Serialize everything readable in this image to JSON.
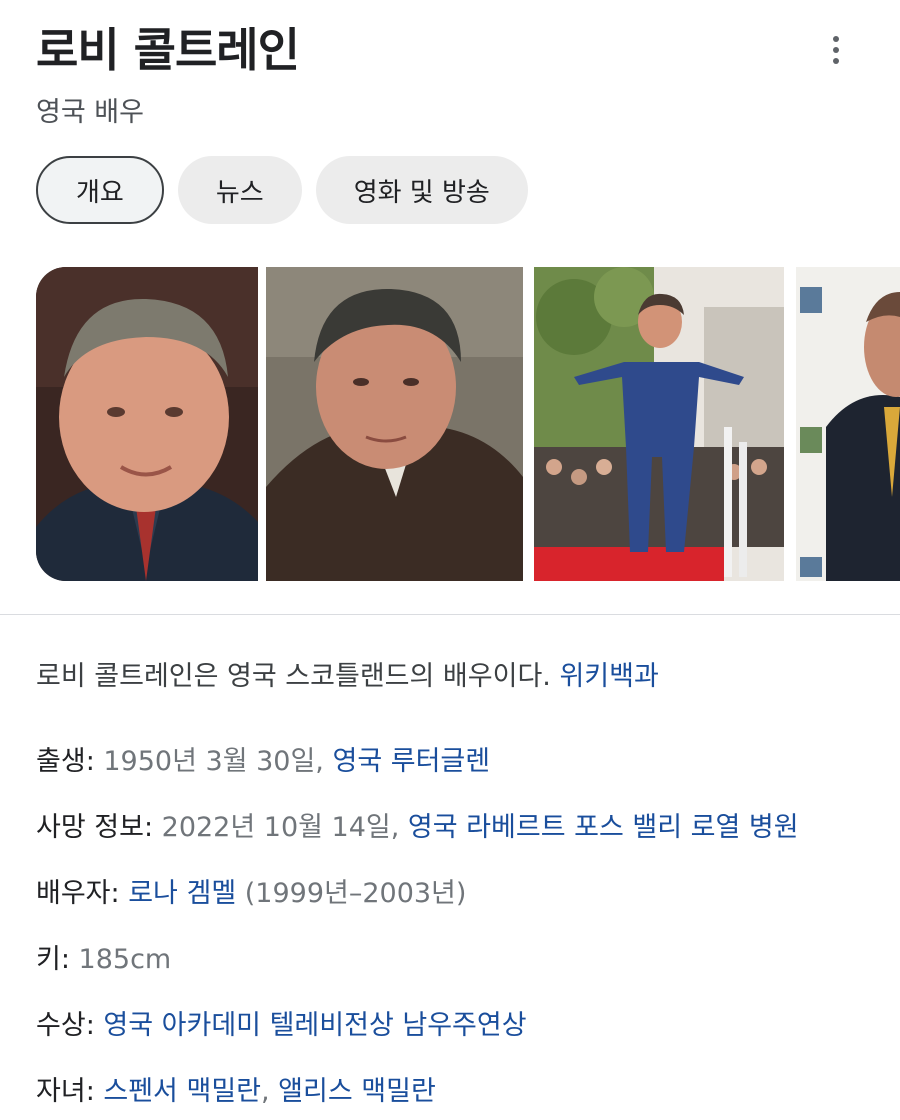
{
  "header": {
    "title": "로비 콜트레인",
    "subtitle": "영국 배우",
    "more_icon": "more-vert-icon"
  },
  "tabs": [
    {
      "label": "개요",
      "active": true
    },
    {
      "label": "뉴스",
      "active": false
    },
    {
      "label": "영화 및 방송",
      "active": false
    }
  ],
  "description": {
    "text": "로비 콜트레인은 영국 스코틀랜드의 배우이다.",
    "source": "위키백과"
  },
  "facts": {
    "born": {
      "label": "출생",
      "value": "1950년 3월 30일, ",
      "link": "영국 루터글렌"
    },
    "death": {
      "label": "사망 정보",
      "value": "2022년 10월 14일, ",
      "link": "영국 라베르트 포스 밸리 로열 병원"
    },
    "spouse": {
      "label": "배우자",
      "link": "로나 겜멜",
      "value": " (1999년–2003년)"
    },
    "height": {
      "label": "키",
      "value": "185cm"
    },
    "awards": {
      "label": "수상",
      "link": "영국 아카데미 텔레비전상 남우주연상"
    },
    "children": {
      "label": "자녀",
      "link1": "스펜서 맥밀란",
      "sep": ", ",
      "link2": "앨리스 맥밀란"
    }
  },
  "colors": {
    "link": "#1a4e9c",
    "chip_bg": "#ececec",
    "text_muted": "#70757a"
  }
}
